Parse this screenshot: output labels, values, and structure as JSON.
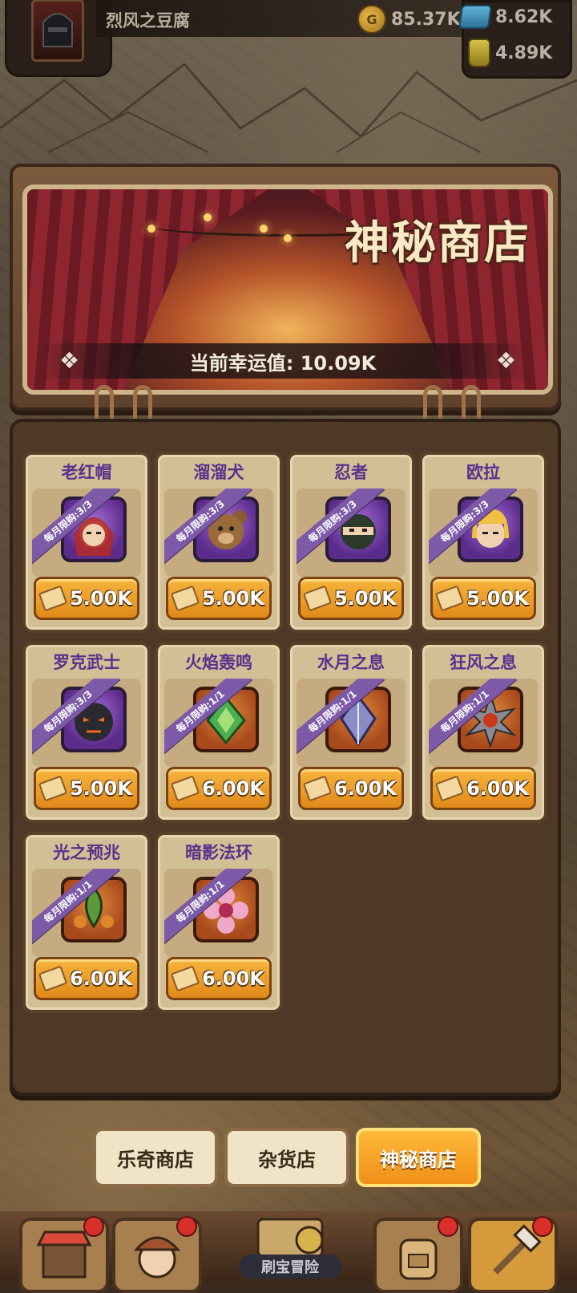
{
  "player": {
    "name": "烈风之豆腐"
  },
  "resources": {
    "gold": "85.37K",
    "gems": "8.62K",
    "potion": "4.89K"
  },
  "banner": {
    "title": "神秘商店",
    "luck_label": "当前幸运值: 10.09K"
  },
  "items": [
    {
      "name": "老红帽",
      "limit": "每月限购:3/3",
      "price": "5.00K",
      "kind": "hero",
      "icon": "red-hood-hero-icon"
    },
    {
      "name": "溜溜犬",
      "limit": "每月限购:3/3",
      "price": "5.00K",
      "kind": "hero",
      "icon": "bear-hero-icon"
    },
    {
      "name": "忍者",
      "limit": "每月限购:3/3",
      "price": "5.00K",
      "kind": "hero",
      "icon": "ninja-hero-icon"
    },
    {
      "name": "欧拉",
      "limit": "每月限购:3/3",
      "price": "5.00K",
      "kind": "hero",
      "icon": "blonde-hero-icon"
    },
    {
      "name": "罗克武士",
      "limit": "每月限购:3/3",
      "price": "5.00K",
      "kind": "hero",
      "icon": "dark-knight-hero-icon"
    },
    {
      "name": "火焰轰鸣",
      "limit": "每月限购:1/1",
      "price": "6.00K",
      "kind": "gear",
      "icon": "green-crystal-icon"
    },
    {
      "name": "水月之息",
      "limit": "每月限购:1/1",
      "price": "6.00K",
      "kind": "gear",
      "icon": "crystal-spear-icon"
    },
    {
      "name": "狂风之息",
      "limit": "每月限购:1/1",
      "price": "6.00K",
      "kind": "gear",
      "icon": "spiked-orb-icon"
    },
    {
      "name": "光之预兆",
      "limit": "每月限购:1/1",
      "price": "6.00K",
      "kind": "gear",
      "icon": "green-leaf-emblem-icon"
    },
    {
      "name": "暗影法环",
      "limit": "每月限购:1/1",
      "price": "6.00K",
      "kind": "gear",
      "icon": "pink-flower-icon"
    }
  ],
  "tabs": [
    {
      "label": "乐奇商店",
      "active": false
    },
    {
      "label": "杂货店",
      "active": false
    },
    {
      "label": "神秘商店",
      "active": true
    }
  ],
  "bottom_nav": {
    "center_label": "刷宝冒险",
    "items": [
      {
        "icon": "shop-stall-icon",
        "badge": true
      },
      {
        "icon": "hero-portrait-icon",
        "badge": true
      },
      {
        "icon": "backpack-icon",
        "badge": true
      },
      {
        "icon": "crafting-hammer-icon",
        "badge": true
      }
    ]
  },
  "colors": {
    "price_button": "#f09a24",
    "item_name": "#5b2f8d",
    "limit_ribbon": "#7c5aa8",
    "active_tab": "#f6a62c",
    "badge": "#d82f2a"
  }
}
